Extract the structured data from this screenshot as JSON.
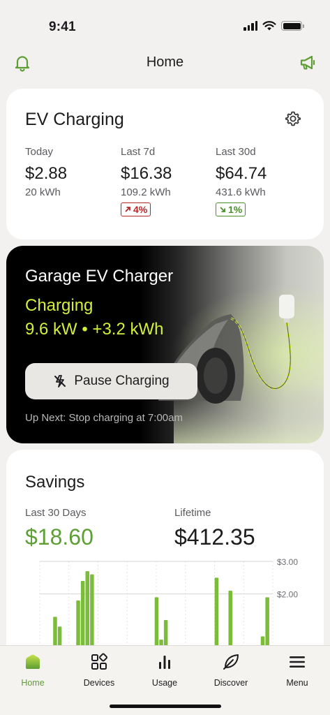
{
  "status_bar": {
    "time": "9:41",
    "icons": [
      "signal-icon",
      "wifi-icon",
      "battery-icon"
    ]
  },
  "header": {
    "title": "Home",
    "left_icon": "bell-icon",
    "right_icon": "megaphone-icon"
  },
  "ev_charging": {
    "title": "EV Charging",
    "settings_icon": "gear-icon",
    "stats": [
      {
        "label": "Today",
        "value": "$2.88",
        "energy": "20 kWh"
      },
      {
        "label": "Last 7d",
        "value": "$16.38",
        "energy": "109.2 kWh",
        "change": "4%",
        "direction": "up"
      },
      {
        "label": "Last 30d",
        "value": "$64.74",
        "energy": "431.6 kWh",
        "change": "1%",
        "direction": "down"
      }
    ]
  },
  "charger": {
    "name": "Garage EV Charger",
    "status": "Charging",
    "power": "9.6 kW • +3.2 kWh",
    "pause_label": "Pause Charging",
    "pause_icon": "power-off-icon",
    "up_next": "Up Next: Stop charging at 7:00am"
  },
  "savings": {
    "title": "Savings",
    "last30_label": "Last 30 Days",
    "last30_value": "$18.60",
    "lifetime_label": "Lifetime",
    "lifetime_value": "$412.35"
  },
  "chart_data": {
    "type": "bar",
    "y_tick_labels": [
      "$3.00",
      "$2.00"
    ],
    "ylim": [
      0,
      3.0
    ],
    "grid": true,
    "values": [
      0,
      0,
      1.3,
      1.0,
      0,
      0,
      0,
      1.8,
      2.4,
      2.7,
      2.6,
      0,
      0,
      0,
      0,
      0,
      0,
      0,
      0,
      0,
      0,
      0,
      0,
      0,
      1.9,
      0.6,
      1.2,
      0,
      0,
      0,
      0,
      0,
      0,
      0,
      0,
      0,
      0,
      2.5,
      0,
      0,
      2.1,
      0,
      0,
      0,
      0,
      0,
      0,
      0.7,
      1.9
    ],
    "color": "#7bbd3a"
  },
  "tabs": [
    {
      "label": "Home",
      "icon": "home-icon",
      "active": true
    },
    {
      "label": "Devices",
      "icon": "devices-icon",
      "active": false
    },
    {
      "label": "Usage",
      "icon": "usage-icon",
      "active": false
    },
    {
      "label": "Discover",
      "icon": "leaf-icon",
      "active": false
    },
    {
      "label": "Menu",
      "icon": "menu-icon",
      "active": false
    }
  ],
  "colors": {
    "accent": "#5d9e35",
    "charging": "#d4ee3a",
    "up": "#b3262a",
    "down": "#4a8f2b",
    "background": "#f3f1ef"
  }
}
